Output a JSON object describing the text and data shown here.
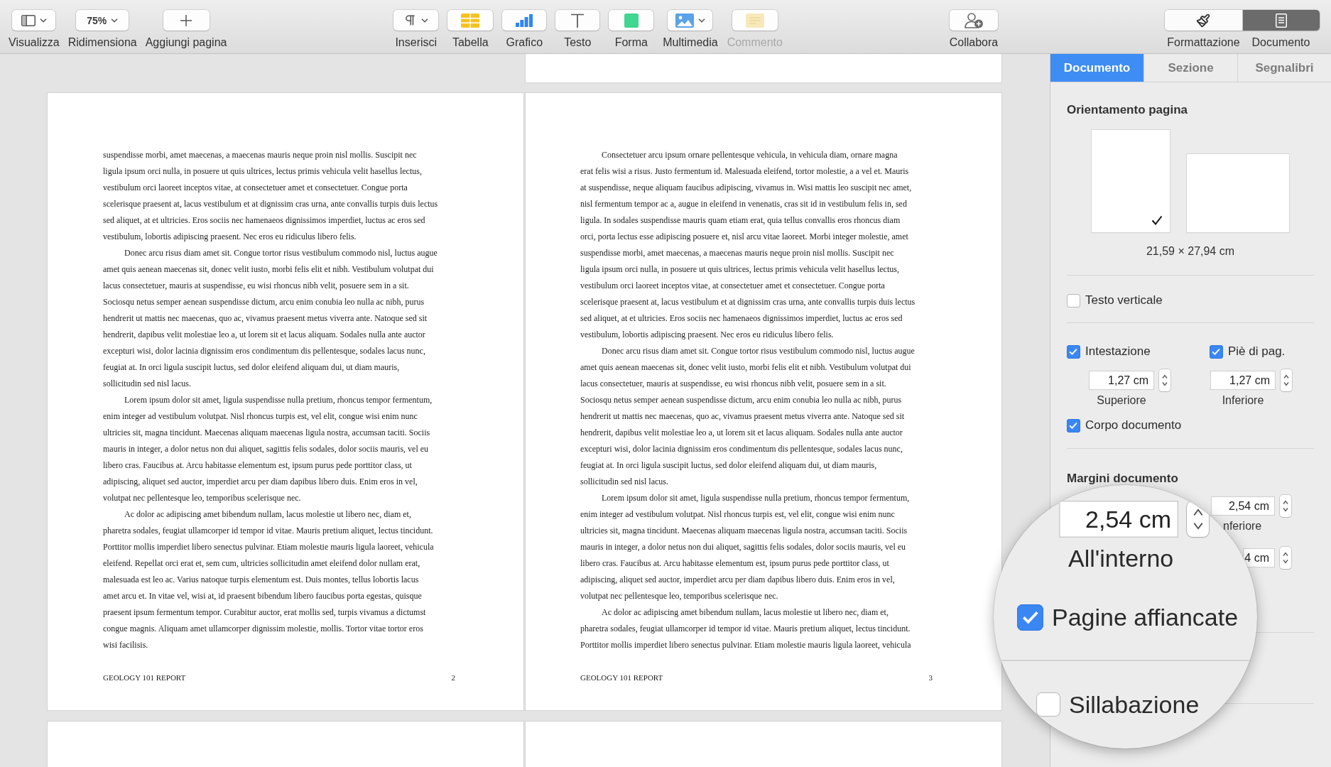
{
  "toolbar": {
    "view_tools": [
      {
        "kind": "view",
        "label": "Visualizza",
        "dropdown": true,
        "disabled": false
      },
      {
        "kind": "zoom",
        "value": "75%",
        "label": "Ridimensiona",
        "dropdown": true,
        "disabled": false
      },
      {
        "kind": "addpage",
        "label": "Aggiungi pagina",
        "dropdown": false,
        "disabled": false
      }
    ],
    "insert_tools": [
      {
        "kind": "insert",
        "label": "Inserisci",
        "dropdown": true,
        "disabled": false
      },
      {
        "kind": "table",
        "label": "Tabella",
        "dropdown": false,
        "disabled": false
      },
      {
        "kind": "chart",
        "label": "Grafico",
        "dropdown": false,
        "disabled": false
      },
      {
        "kind": "text",
        "label": "Testo",
        "dropdown": false,
        "disabled": false
      },
      {
        "kind": "shape",
        "label": "Forma",
        "dropdown": false,
        "disabled": false
      },
      {
        "kind": "media",
        "label": "Multimedia",
        "dropdown": true,
        "disabled": false
      },
      {
        "kind": "comment",
        "label": "Commento",
        "dropdown": false,
        "disabled": true
      }
    ],
    "share_tools": [
      {
        "kind": "collaborate",
        "label": "Collabora",
        "dropdown": false,
        "disabled": false
      }
    ],
    "inspector_switch": [
      {
        "kind": "format",
        "label": "Formattazione",
        "selected": false
      },
      {
        "kind": "document",
        "label": "Documento",
        "selected": true
      }
    ]
  },
  "pages": [
    {
      "paragraphs": [
        {
          "first_line_indent": false,
          "lines": [
            "suspendisse morbi, amet maecenas, a maecenas mauris neque proin nisl mollis. Suscipit nec",
            "ligula ipsum orci nulla, in posuere ut quis ultrices, lectus primis vehicula velit hasellus lectus,",
            "vestibulum orci laoreet inceptos vitae, at consectetuer amet et consectetuer. Congue porta",
            "scelerisque praesent at, lacus vestibulum et at dignissim cras urna, ante convallis turpis duis lectus",
            "sed aliquet, at et ultricies. Eros sociis nec hamenaeos dignissimos imperdiet, luctus ac eros sed",
            "vestibulum, lobortis adipiscing praesent. Nec eros eu ridiculus libero felis."
          ]
        },
        {
          "first_line_indent": true,
          "lines": [
            "Donec arcu risus diam amet sit. Congue tortor risus vestibulum commodo nisl, luctus augue",
            "amet quis aenean maecenas sit, donec velit iusto, morbi felis elit et nibh. Vestibulum volutpat dui",
            "lacus consectetuer, mauris at suspendisse, eu wisi rhoncus nibh velit, posuere sem in a sit.",
            "Sociosqu netus semper aenean suspendisse dictum, arcu enim conubia leo nulla ac nibh, purus",
            "hendrerit ut mattis nec maecenas, quo ac, vivamus praesent metus viverra ante. Natoque sed sit",
            "hendrerit, dapibus velit molestiae leo a, ut lorem sit et lacus aliquam. Sodales nulla ante auctor",
            "excepturi wisi, dolor lacinia dignissim eros condimentum dis pellentesque, sodales lacus nunc,",
            "feugiat at. In orci ligula suscipit luctus, sed dolor eleifend aliquam dui, ut diam mauris,",
            "sollicitudin sed nisl lacus."
          ]
        },
        {
          "first_line_indent": true,
          "lines": [
            "Lorem ipsum dolor sit amet, ligula suspendisse nulla pretium, rhoncus tempor fermentum,",
            "enim integer ad vestibulum volutpat. Nisl rhoncus turpis est, vel elit, congue wisi enim nunc",
            "ultricies sit, magna tincidunt. Maecenas aliquam maecenas ligula nostra, accumsan taciti. Sociis",
            "mauris in integer, a dolor netus non dui aliquet, sagittis felis sodales, dolor sociis mauris, vel eu",
            "libero cras. Faucibus at. Arcu habitasse elementum est, ipsum purus pede porttitor class, ut",
            "adipiscing, aliquet sed auctor, imperdiet arcu per diam dapibus libero duis. Enim eros in vel,",
            "volutpat nec pellentesque leo, temporibus scelerisque nec."
          ]
        },
        {
          "first_line_indent": true,
          "lines": [
            "Ac dolor ac adipiscing amet bibendum nullam, lacus molestie ut libero nec, diam et,",
            "pharetra sodales, feugiat ullamcorper id tempor id vitae. Mauris pretium aliquet, lectus tincidunt.",
            "Porttitor mollis imperdiet libero senectus pulvinar. Etiam molestie mauris ligula laoreet, vehicula",
            "eleifend. Repellat orci erat et, sem cum, ultricies sollicitudin amet eleifend dolor nullam erat,",
            "malesuada est leo ac. Varius natoque turpis elementum est. Duis montes, tellus lobortis lacus",
            "amet arcu et. In vitae vel, wisi at, id praesent bibendum libero faucibus porta egestas, quisque",
            "praesent ipsum fermentum tempor. Curabitur auctor, erat mollis sed, turpis vivamus a dictumst",
            "congue magnis. Aliquam amet ullamcorper dignissim molestie, mollis. Tortor vitae tortor eros",
            "wisi facilisis."
          ]
        }
      ],
      "footer": {
        "title": "GEOLOGY 101 REPORT",
        "number": "2"
      }
    },
    {
      "paragraphs": [
        {
          "first_line_indent": true,
          "lines": [
            "Consectetuer arcu ipsum ornare pellentesque vehicula, in vehicula diam, ornare magna",
            "erat felis wisi a risus. Justo fermentum id. Malesuada eleifend, tortor molestie, a a vel et. Mauris",
            "at suspendisse, neque aliquam faucibus adipiscing, vivamus in. Wisi mattis leo suscipit nec amet,",
            "nisl fermentum tempor ac a, augue in eleifend in venenatis, cras sit id in vestibulum felis in, sed",
            "ligula. In sodales suspendisse mauris quam etiam erat, quia tellus convallis eros rhoncus diam",
            "orci, porta lectus esse adipiscing posuere et, nisl arcu vitae laoreet. Morbi integer molestie, amet",
            "suspendisse morbi, amet maecenas, a maecenas mauris neque proin nisl mollis. Suscipit nec",
            "ligula ipsum orci nulla, in posuere ut quis ultrices, lectus primis vehicula velit hasellus lectus,",
            "vestibulum orci laoreet inceptos vitae, at consectetuer amet et consectetuer. Congue porta",
            "scelerisque praesent at, lacus vestibulum et at dignissim cras urna, ante convallis turpis duis lectus",
            "sed aliquet, at et ultricies. Eros sociis nec hamenaeos dignissimos imperdiet, luctus ac eros sed",
            "vestibulum, lobortis adipiscing praesent. Nec eros eu ridiculus libero felis."
          ]
        },
        {
          "first_line_indent": true,
          "lines": [
            "Donec arcu risus diam amet sit. Congue tortor risus vestibulum commodo nisl, luctus augue",
            "amet quis aenean maecenas sit, donec velit iusto, morbi felis elit et nibh. Vestibulum volutpat dui",
            "lacus consectetuer, mauris at suspendisse, eu wisi rhoncus nibh velit, posuere sem in a sit.",
            "Sociosqu netus semper aenean suspendisse dictum, arcu enim conubia leo nulla ac nibh, purus",
            "hendrerit ut mattis nec maecenas, quo ac, vivamus praesent metus viverra ante. Natoque sed sit",
            "hendrerit, dapibus velit molestiae leo a, ut lorem sit et lacus aliquam. Sodales nulla ante auctor",
            "excepturi wisi, dolor lacinia dignissim eros condimentum dis pellentesque, sodales lacus nunc,",
            "feugiat at. In orci ligula suscipit luctus, sed dolor eleifend aliquam dui, ut diam mauris,",
            "sollicitudin sed nisl lacus."
          ]
        },
        {
          "first_line_indent": true,
          "lines": [
            "Lorem ipsum dolor sit amet, ligula suspendisse nulla pretium, rhoncus tempor fermentum,",
            "enim integer ad vestibulum volutpat. Nisl rhoncus turpis est, vel elit, congue wisi enim nunc",
            "ultricies sit, magna tincidunt. Maecenas aliquam maecenas ligula nostra, accumsan taciti. Sociis",
            "mauris in integer, a dolor netus non dui aliquet, sagittis felis sodales, dolor sociis mauris, vel eu",
            "libero cras. Faucibus at. Arcu habitasse elementum est, ipsum purus pede porttitor class, ut",
            "adipiscing, aliquet sed auctor, imperdiet arcu per diam dapibus libero duis. Enim eros in vel,",
            "volutpat nec pellentesque leo, temporibus scelerisque nec."
          ]
        },
        {
          "first_line_indent": true,
          "lines": [
            "Ac dolor ac adipiscing amet bibendum nullam, lacus molestie ut libero nec, diam et,",
            "pharetra sodales, feugiat ullamcorper id tempor id vitae. Mauris pretium aliquet, lectus tincidunt.",
            "Porttitor mollis imperdiet libero senectus pulvinar. Etiam molestie mauris ligula laoreet, vehicula"
          ]
        }
      ],
      "footer": {
        "title": "GEOLOGY 101 REPORT",
        "number": "3"
      }
    }
  ],
  "inspector": {
    "tabs": [
      {
        "label": "Documento",
        "selected": true
      },
      {
        "label": "Sezione",
        "selected": false
      },
      {
        "label": "Segnalibri",
        "selected": false
      }
    ],
    "page_orientation": {
      "title": "Orientamento pagina",
      "options": [
        {
          "kind": "portrait",
          "selected": true
        },
        {
          "kind": "landscape",
          "selected": false
        }
      ],
      "size": "21,59 × 27,94 cm"
    },
    "vertical_text": {
      "label": "Testo verticale",
      "checked": false
    },
    "header": {
      "label": "Intestazione",
      "checked": true,
      "value": "1,27 cm",
      "caption": "Superiore"
    },
    "footer": {
      "label": "Piè di pag.",
      "checked": true,
      "value": "1,27 cm",
      "caption": "Inferiore"
    },
    "document_body": {
      "label": "Corpo documento",
      "checked": true
    },
    "margins": {
      "title": "Margini documento",
      "fields": [
        {
          "value": "2,54 cm",
          "caption": "nferiore"
        },
        {
          "value": "4 cm"
        }
      ]
    },
    "magnifier": {
      "field": {
        "value": "2,54 cm",
        "caption": "All'interno"
      },
      "facing_pages": {
        "label": "Pagine affiancate",
        "checked": true
      },
      "hyphenation": {
        "label": "Sillabazione",
        "checked": false
      }
    }
  }
}
